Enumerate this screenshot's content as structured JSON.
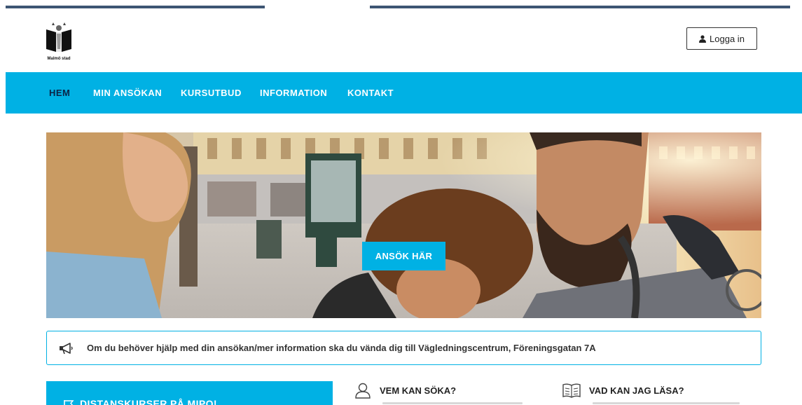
{
  "header": {
    "logo_caption": "Malmö stad",
    "login_label": "Logga in"
  },
  "nav": {
    "items": [
      {
        "label": "HEM",
        "active": true
      },
      {
        "label": "MIN ANSÖKAN",
        "active": false
      },
      {
        "label": "KURSUTBUD",
        "active": false
      },
      {
        "label": "INFORMATION",
        "active": false
      },
      {
        "label": "KONTAKT",
        "active": false
      }
    ]
  },
  "hero": {
    "apply_label": "ANSÖK HÄR"
  },
  "notice": {
    "text": "Om du behöver hjälp med din ansökan/mer information ska du vända dig till Vägledningscentrum, Föreningsgatan 7A"
  },
  "sections": {
    "distance_courses": "DISTANSKURSER PÅ MIPO!",
    "who_can_apply": "VEM KAN SÖKA?",
    "what_can_i_study": "VAD KAN JAG LÄSA?"
  },
  "colors": {
    "accent": "#00b1e4",
    "nav_active": "#0b2346",
    "top_strip": "#3d5573"
  },
  "icons": {
    "login": "user-icon",
    "notice": "megaphone-icon",
    "distance": "flag-icon",
    "who": "person-outline-icon",
    "what": "open-book-icon"
  }
}
